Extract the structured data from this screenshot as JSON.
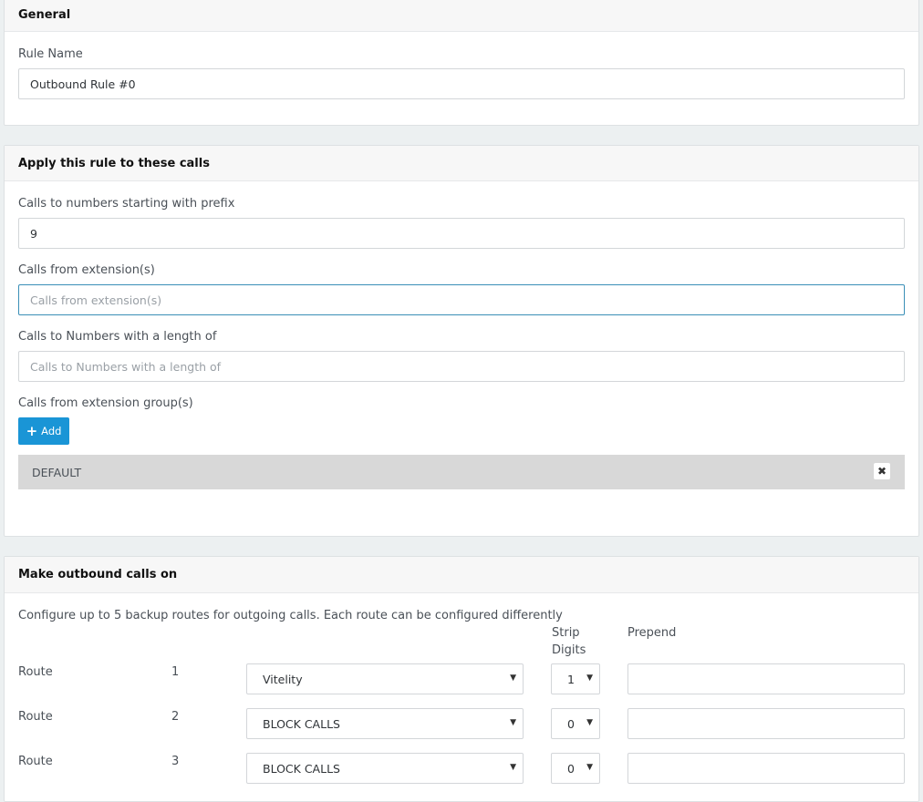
{
  "general": {
    "title": "General",
    "rule_name_label": "Rule Name",
    "rule_name_value": "Outbound Rule #0"
  },
  "apply": {
    "title": "Apply this rule to these calls",
    "prefix_label": "Calls to numbers starting with prefix",
    "prefix_value": "9",
    "ext_label": "Calls from extension(s)",
    "ext_placeholder": "Calls from extension(s)",
    "length_label": "Calls to Numbers with a length of",
    "length_placeholder": "Calls to Numbers with a length of",
    "group_label": "Calls from extension group(s)",
    "add_label": "Add",
    "groups": [
      "DEFAULT"
    ]
  },
  "outbound": {
    "title": "Make outbound calls on",
    "description": "Configure up to 5 backup routes for outgoing calls. Each route can be configured differently",
    "strip_header_1": "Strip",
    "strip_header_2": "Digits",
    "prepend_header": "Prepend",
    "routes": [
      {
        "label": "Route",
        "number": "1",
        "trunk": "Vitelity",
        "strip": "1",
        "prepend": ""
      },
      {
        "label": "Route",
        "number": "2",
        "trunk": "BLOCK CALLS",
        "strip": "0",
        "prepend": ""
      },
      {
        "label": "Route",
        "number": "3",
        "trunk": "BLOCK CALLS",
        "strip": "0",
        "prepend": ""
      }
    ]
  },
  "colors": {
    "add_button": "#1a95d6",
    "focus_border": "#3a8fb7",
    "page_bg": "#ecf0f1"
  }
}
